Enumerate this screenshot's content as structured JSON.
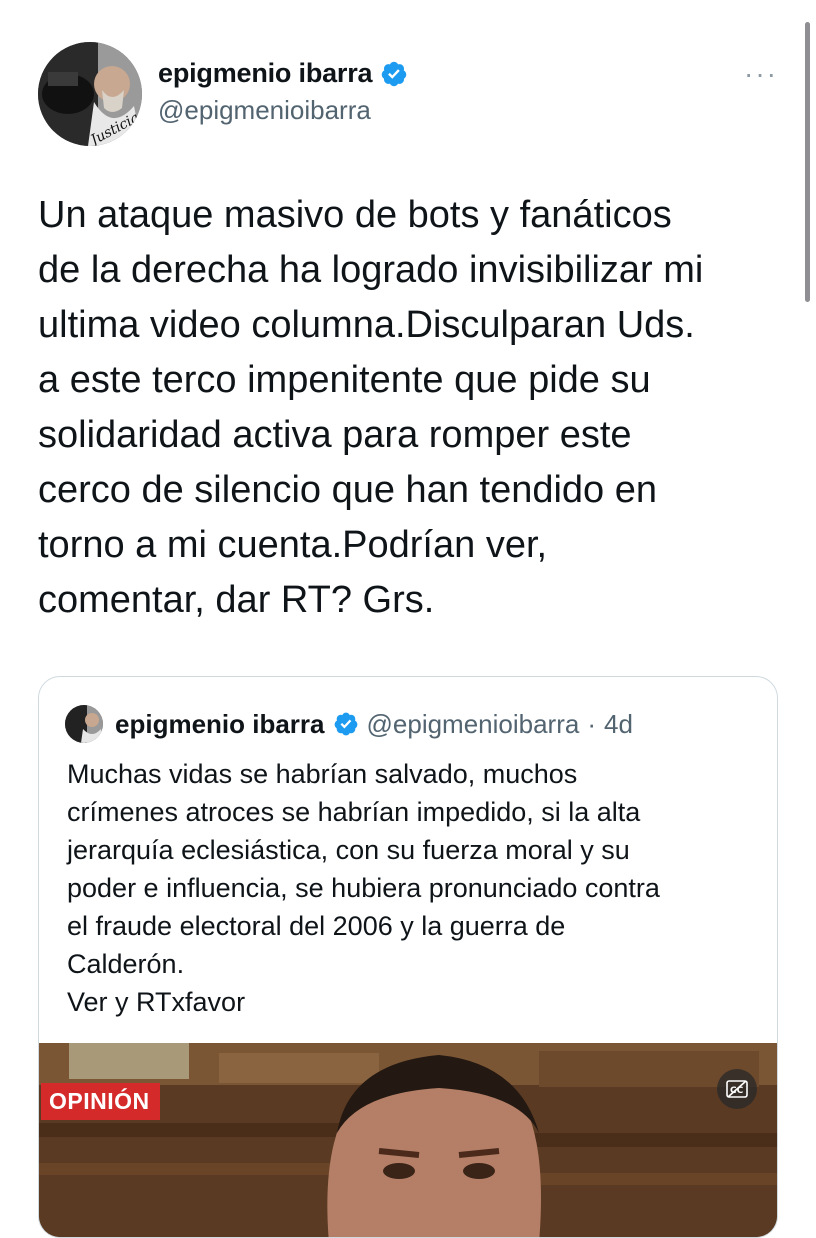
{
  "author": {
    "display_name": "epigmenio ibarra",
    "handle": "@epigmenioibarra",
    "avatar_text": "Justicia"
  },
  "tweet": {
    "text": "Un ataque masivo de bots y fanáticos\nde la derecha ha logrado invisibilizar mi\nultima video columna.Disculparan Uds.\na este terco impenitente que pide su\nsolidaridad activa para romper este\ncerco de silencio que han tendido en\ntorno a mi cuenta.Podrían ver,\ncomentar, dar RT? Grs."
  },
  "quoted_tweet": {
    "display_name": "epigmenio ibarra",
    "handle": "@epigmenioibarra",
    "separator": "·",
    "time": "4d",
    "text": "Muchas vidas se habrían salvado, muchos\ncrímenes atroces se habrían impedido, si la alta\njerarquía eclesiástica, con su fuerza moral y su\npoder e influencia, se hubiera pronunciado contra\nel fraude electoral del 2006 y la guerra de\nCalderón.\nVer y RTxfavor",
    "media_badge": "OPINIÓN"
  },
  "icons": {
    "verified": "verified-badge-icon",
    "more": "more-options-icon",
    "captions": "closed-captions-icon"
  },
  "colors": {
    "verified_blue": "#1d9bf0",
    "secondary_text": "#536471",
    "badge_red": "#d42a2a"
  }
}
